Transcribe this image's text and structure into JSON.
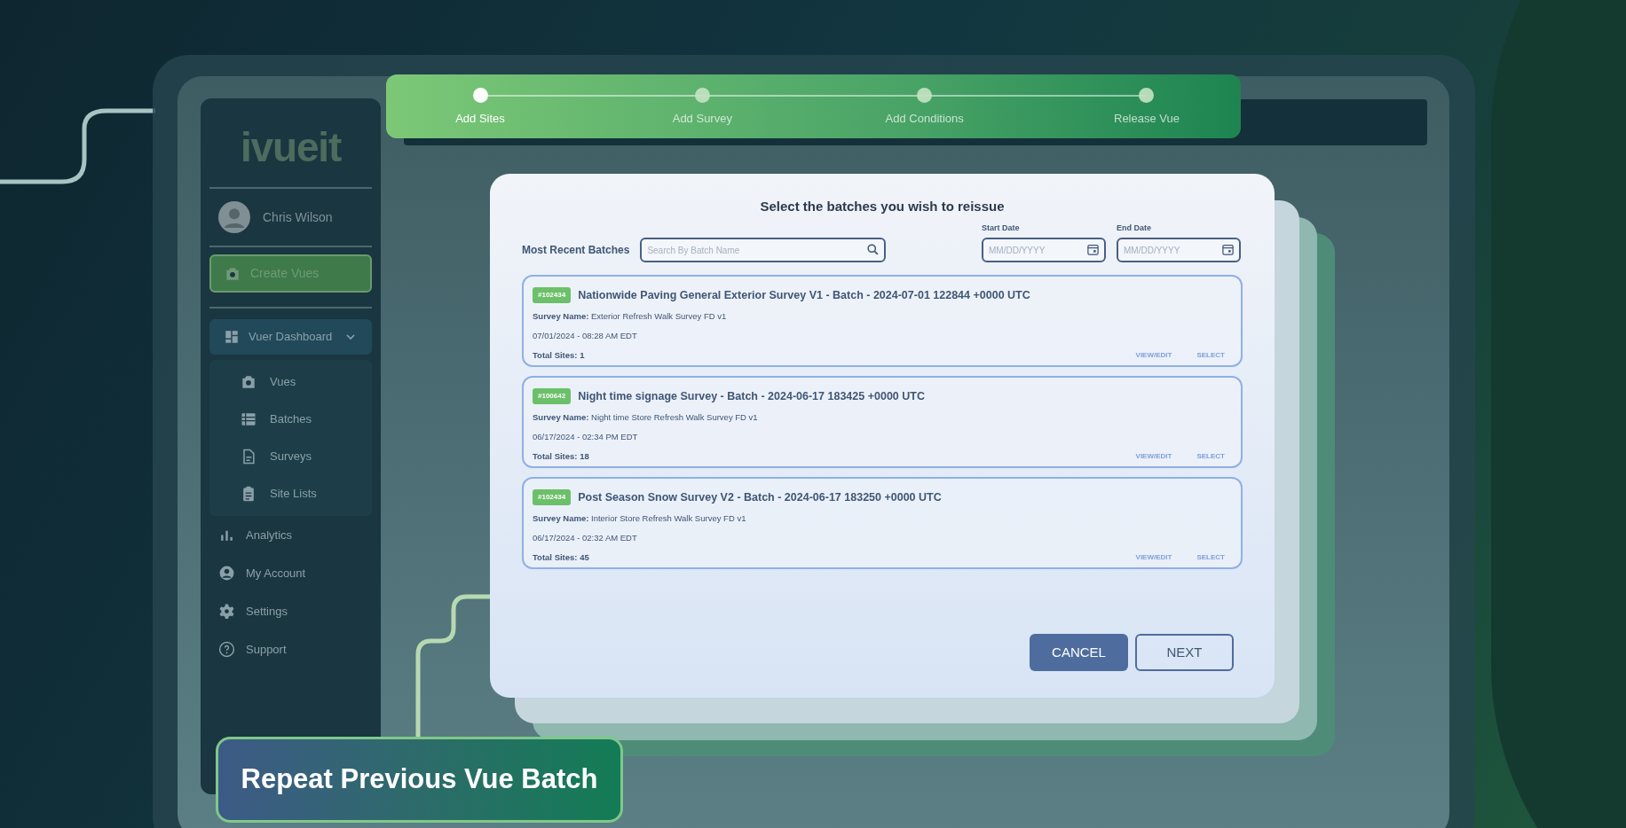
{
  "stepper": {
    "steps": [
      {
        "label": "Add Sites",
        "selected": true
      },
      {
        "label": "Add Survey",
        "selected": false
      },
      {
        "label": "Add Conditions",
        "selected": false
      },
      {
        "label": "Release Vue",
        "selected": false
      }
    ]
  },
  "sidebar": {
    "logo": "ivueit",
    "user": "Chris Wilson",
    "create_button": "Create Vues",
    "items": [
      {
        "label": "Vuer Dashboard",
        "expanded": true,
        "children": [
          {
            "label": "Vues"
          },
          {
            "label": "Batches"
          },
          {
            "label": "Surveys"
          },
          {
            "label": "Site Lists"
          }
        ]
      },
      {
        "label": "Analytics"
      },
      {
        "label": "My Account"
      },
      {
        "label": "Settings"
      },
      {
        "label": "Support"
      }
    ]
  },
  "dialog": {
    "title": "Select the batches you wish to reissue",
    "search_label": "Most Recent Batches",
    "search": {
      "placeholder": "Search By Batch Name"
    },
    "start_date": {
      "label": "Start Date",
      "placeholder": "MM/DD/YYYY"
    },
    "end_date": {
      "label": "End Date",
      "placeholder": "MM/DD/YYYY"
    },
    "batches": [
      {
        "id": "#102434",
        "title": "Nationwide Paving General Exterior Survey V1 - Batch - 2024-07-01 122844 +0000 UTC",
        "survey": "**Survey Name:** Exterior Refresh Walk Survey FD v1",
        "date": "07/01/2024 - 08:28 AM EDT",
        "total_sites": "Total Sites: 1",
        "actions": [
          "VIEW/EDIT",
          "SELECT"
        ]
      },
      {
        "id": "#100642",
        "title": "Night time signage Survey - Batch - 2024-06-17 183425 +0000 UTC",
        "survey": "**Survey Name:** Night time Store Refresh Walk Survey FD v1",
        "date": "06/17/2024 - 02:34 PM EDT",
        "total_sites": "Total Sites: 18",
        "actions": [
          "VIEW/EDIT",
          "SELECT"
        ]
      },
      {
        "id": "#102434",
        "title": "Post Season Snow Survey V2 - Batch - 2024-06-17 183250 +0000 UTC",
        "survey": "**Survey Name:** Interior Store Refresh Walk Survey FD v1",
        "date": "06/17/2024 - 02:32 AM EDT",
        "total_sites": "Total Sites: 45",
        "actions": [
          "VIEW/EDIT",
          "SELECT"
        ]
      }
    ],
    "buttons": [
      {
        "label": "CANCEL",
        "kind": "primary"
      },
      {
        "label": "NEXT",
        "kind": "secondary"
      }
    ]
  },
  "caption": "Repeat Previous Vue Batch"
}
